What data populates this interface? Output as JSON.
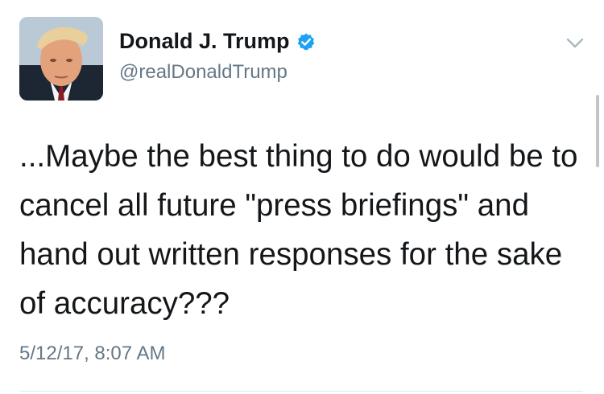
{
  "author": {
    "name": "Donald J. Trump",
    "handle": "@realDonaldTrump",
    "verified": true
  },
  "tweet": {
    "text": "...Maybe the best thing to do would be to cancel all future \"press briefings\" and hand out written responses for the sake of accuracy???",
    "timestamp": "5/12/17, 8:07 AM"
  },
  "icons": {
    "verified": "verified-badge-icon",
    "menu": "chevron-down-icon"
  },
  "colors": {
    "verified_blue": "#1da1f2",
    "secondary_text": "#657786",
    "primary_text": "#14171a"
  }
}
